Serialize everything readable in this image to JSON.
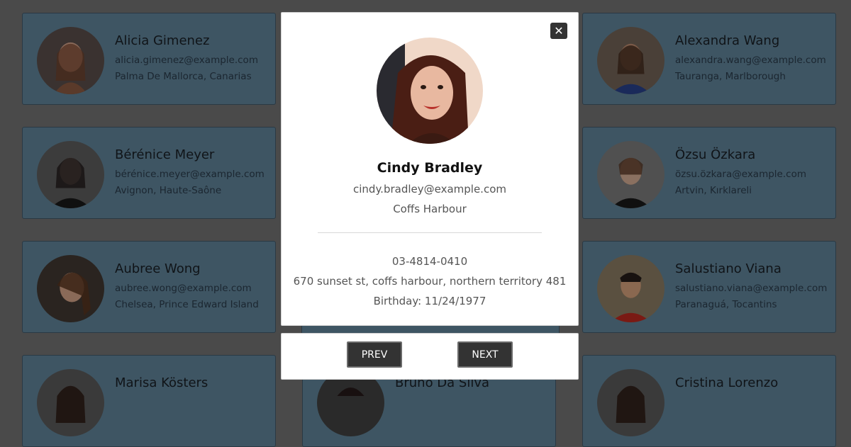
{
  "cards": [
    {
      "name": "Alicia Gimenez",
      "email": "alicia.gimenez@example.com",
      "location": "Palma De Mallorca, Canarias",
      "avatar": "portrait-woman-light"
    },
    {
      "name": "Alexandra Wang",
      "email": "alexandra.wang@example.com",
      "location": "Tauranga, Marlborough",
      "avatar": "portrait-woman-dark"
    },
    {
      "name": "Bérénice Meyer",
      "email": "bérénice.meyer@example.com",
      "location": "Avignon, Haute-Saône",
      "avatar": "portrait-woman-dark"
    },
    {
      "name": "Özsu Özkara",
      "email": "özsu.özkara@example.com",
      "location": "Artvin, Kırklareli",
      "avatar": "portrait-woman-light"
    },
    {
      "name": "Aubree Wong",
      "email": "aubree.wong@example.com",
      "location": "Chelsea, Prince Edward Island",
      "avatar": "portrait-woman-light"
    },
    {
      "name": "Salustiano Viana",
      "email": "salustiano.viana@example.com",
      "location": "Paranaguá, Tocantins",
      "avatar": "portrait-man"
    },
    {
      "name": "Marisa Kösters",
      "email": "",
      "location": "",
      "avatar": "portrait-woman-dark"
    },
    {
      "name": "Bruno Da Silva",
      "email": "",
      "location": "",
      "avatar": "portrait-man"
    },
    {
      "name": "Cristina Lorenzo",
      "email": "",
      "location": "",
      "avatar": "portrait-woman-dark"
    }
  ],
  "modal": {
    "close_label": "✕",
    "name": "Cindy Bradley",
    "email": "cindy.bradley@example.com",
    "city": "Coffs Harbour",
    "phone": "03-4814-0410",
    "address": "670 sunset st, coffs harbour, northern territory 481",
    "birthday": "Birthday: 11/24/1977"
  },
  "nav": {
    "prev_label": "PREV",
    "next_label": "NEXT"
  }
}
